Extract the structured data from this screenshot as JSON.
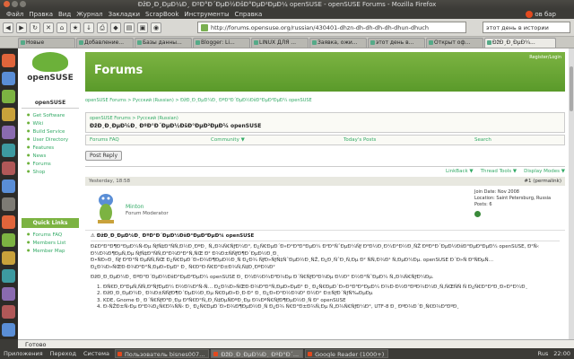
{
  "window": {
    "title": "ÐžÐ¸Ð¸ÐµÐ¼Ð¸ ÐºÐ°Ð´ÐµÐ½ÐšÐ°ÐµÐ²ÐµÐ¼ openSUSE - openSUSE Forums - Mozilla Firefox"
  },
  "menu": [
    "Файл",
    "Правка",
    "Вид",
    "Журнал",
    "Закладки",
    "ScrapBook",
    "Инструменты",
    "Справка"
  ],
  "top_right": {
    "label": "ов бар"
  },
  "url": "http://forums.opensuse.org/russian/430401-dhzn-dh-dh-dh-dh-dhun-dhuch",
  "search_placeholder": "этот день в истории",
  "tabs": [
    {
      "label": "Новые"
    },
    {
      "label": "Добавление..."
    },
    {
      "label": "Базы данны..."
    },
    {
      "label": "Blogger: Li..."
    },
    {
      "label": "LINUX ДЛЯ ..."
    },
    {
      "label": "Заявка, ожи..."
    },
    {
      "label": "этот день в..."
    },
    {
      "label": "Открыт оф..."
    },
    {
      "label": "ÐžÐ¸Ð¸ÐµÐ¼..."
    }
  ],
  "site": {
    "logo_text": "openSUSE",
    "banner_title": "Forums",
    "login": "Register/Login"
  },
  "left_nav": {
    "header": "openSUSE",
    "items": [
      "Get Software",
      "Wiki",
      "Build Service",
      "User Directory",
      "Features",
      "News",
      "Forums",
      "Shop"
    ],
    "quick_header": "Quick Links",
    "quick_items": [
      "Forums FAQ",
      "Members List",
      "Member Map"
    ]
  },
  "content": {
    "breadcrumb": "openSUSE Forums > Русский (Russian) > ÐžÐ¸Ð¸ÐµÐ¼Ð¸ ÐºÐ°Ð´ÐµÐ½ÐšÐ°ÐµÐ²ÐµÐ¼ openSUSE",
    "crumb2": "openSUSE Forums > Русский (Russian)",
    "thread_title": "ÐžÐ¸Ð¸ÐµÐ¼Ð¸ ÐºÐ°Ð´ÐµÐ½ÐšÐ°ÐµÐ²ÐµÐ¼ openSUSE",
    "nav": [
      "Forums FAQ",
      "Community ▼",
      "Today's Posts",
      "Search"
    ],
    "post_reply": "Post Reply",
    "thread_tools": [
      "LinkBack ▼",
      "Thread Tools ▼",
      "Display Modes ▼"
    ],
    "post_date": "Yesterday, 18:58",
    "permalink": "#1 (permalink)",
    "user": {
      "name": "Minton",
      "title": "Forum Moderator"
    },
    "join": {
      "date": "Join Date: Nov 2008",
      "location": "Location: Saint Petersburg, Russia",
      "posts": "Posts: 6"
    },
    "post_title": "ÐžÐ¸Ð¸ÐµÐ¼Ð¸ ÐºÐ°Ð´ÐµÐ½ÐšÐ°ÐµÐ²ÐµÐ¼ openSUSE",
    "paragraphs": [
      "Ð£Ð²Ð°Ð¶Ð°ÐµÐ¼Ñ‹Ðµ ÑƒÑ‡Ð°ÑÑ‚Ð½Ð¸ÐºÐ¸ Ñ„Ð¾Ñ€ÑƒÐ¼Ð°, Ð¿Ñ€ÐµÐ´Ð»Ð°Ð³Ð°ÐµÐ¼ Ð²Ð°ÑˆÐµÐ¼Ñƒ Ð²Ð½Ð¸Ð¼Ð°Ð½Ð¸ÑŽ ÐºÐ°Ð´ÐµÐ½ÐšÐ°ÐµÐ²ÐµÐ¼ openSUSE, Ð²Ñ‹ Ð¼Ð¾Ð¶ÐµÑ‚Ðµ ÑƒÑ‡Ð°ÑÑ‚Ð²Ð¾Ð²Ð°Ñ‚ÑŒ Ð² Ð¾Ð±ÑÑƒÐ¶Ð´ÐµÐ½Ð¸Ð¸",
      "Ð•ÑÐ»Ð¸ Ñƒ Ð²Ð°Ñ ÐµÑÑ‚ÑŒ Ð¿Ñ€ÐµÐ´Ð»Ð¾Ð¶ÐµÐ½Ð¸Ñ Ð¿Ð¾ ÑƒÐ»ÑƒÑ‡ÑˆÐµÐ½Ð¸ÑŽ, Ð¿Ð¸ÑˆÐ¸Ñ‚Ðµ Ð² ÑÑ‚Ð¾Ð¹ Ñ‚ÐµÐ¼Ðµ. openSUSE Ð´Ð»Ñ Ð²ÑÐµÑ… Ð¿Ð¾Ð»ÑŒÐ·Ð¾Ð²Ð°Ñ‚ÐµÐ»ÐµÐ¹ Ð¸ Ñ€Ð°Ð·Ñ€Ð°Ð±Ð¾Ñ‚Ñ‡Ð¸ÐºÐ¾Ð²",
      "ÐžÐ¸Ð¸ÐµÐ¼Ð¸ ÐºÐ°Ð´ÐµÐ½ÐšÐ°ÐµÐ²ÐµÐ¼ openSUSE Ð¸ Ð¼Ð½Ð¾Ð³Ð¾Ðµ Ð´Ñ€ÑƒÐ³Ð¾Ðµ Ð½Ð° Ð½Ð°ÑˆÐµÐ¼ Ñ„Ð¾Ñ€ÑƒÐ¼Ðµ."
    ],
    "list_items": [
      "ÐÑ€Ð¸Ð²ÐµÑ‚ÑÑ‚Ð²ÑƒÐµÐ¼ Ð½Ð¾Ð²Ñ‹Ñ… Ð¿Ð¾Ð»ÑŒÐ·Ð¾Ð²Ð°Ñ‚ÐµÐ»ÐµÐ¹ Ð¸ Ð¿Ñ€ÐµÐ´Ð»Ð°Ð³Ð°ÐµÐ¼ Ð¾Ð·Ð½Ð°ÐºÐ¾Ð¼Ð¸Ñ‚ÑŒÑÑ Ñ Ð¿Ñ€Ð°Ð²Ð¸Ð»Ð°Ð¼Ð¸",
      "ÐžÐ¸Ð¸ÐµÐ¼Ð¸ Ð¾Ð±ÑÑƒÐ¶Ð´ÐµÐ½Ð¸Ðµ Ñ€ÐµÐ»Ð¸Ð·Ð° Ð¸ Ð¿Ð»Ð°Ð½Ð¾Ð² Ð½Ð° Ð±ÑƒÐ´ÑƒÑ‰ÐµÐµ",
      "KDE, Gnome Ð¸ Ð´Ñ€ÑƒÐ³Ð¸Ðµ Ð³Ñ€Ð°Ñ„Ð¸Ñ‡ÐµÑÐºÐ¸Ðµ Ð¾ÐºÑ€ÑƒÐ¶ÐµÐ½Ð¸Ñ Ð² openSUSE",
      "Ð›ÑŽÐ±Ñ‹Ðµ Ð²Ð¾Ð¿Ñ€Ð¾ÑÑ‹ Ð¸ Ð¿Ñ€ÐµÐ´Ð»Ð¾Ð¶ÐµÐ½Ð¸Ñ Ð¿Ð¾ Ñ€Ð°Ð±Ð¾Ñ‚Ðµ Ñ„Ð¾Ñ€ÑƒÐ¼Ð°, UTF-8 Ð¸ ÐºÐ¾Ð´Ð¸Ñ€Ð¾Ð²ÐºÐ¸"
    ]
  },
  "statusbar": "Готово",
  "taskbar": {
    "menus": [
      "Приложения",
      "Переход",
      "Система"
    ],
    "tasks": [
      {
        "label": "Пользователь bisnes007...",
        "active": false
      },
      {
        "label": "ÐžÐ¸Ð¸ÐµÐ¼Ð¸ ÐºÐ°Ð´...",
        "active": true
      },
      {
        "label": "Google Reader (1000+)",
        "active": false
      }
    ],
    "time": "22:00",
    "locale": "Rus"
  }
}
